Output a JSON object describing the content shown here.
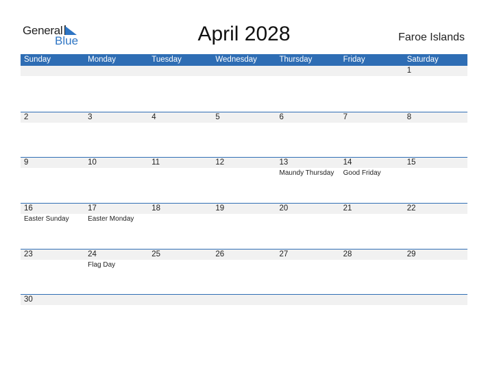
{
  "logo": {
    "word1": "General",
    "word2": "Blue"
  },
  "title": "April 2028",
  "country": "Faroe Islands",
  "weekdays": [
    "Sunday",
    "Monday",
    "Tuesday",
    "Wednesday",
    "Thursday",
    "Friday",
    "Saturday"
  ],
  "weeks": [
    [
      {
        "day": ""
      },
      {
        "day": ""
      },
      {
        "day": ""
      },
      {
        "day": ""
      },
      {
        "day": ""
      },
      {
        "day": ""
      },
      {
        "day": "1"
      }
    ],
    [
      {
        "day": "2"
      },
      {
        "day": "3"
      },
      {
        "day": "4"
      },
      {
        "day": "5"
      },
      {
        "day": "6"
      },
      {
        "day": "7"
      },
      {
        "day": "8"
      }
    ],
    [
      {
        "day": "9"
      },
      {
        "day": "10"
      },
      {
        "day": "11"
      },
      {
        "day": "12"
      },
      {
        "day": "13",
        "holiday": "Maundy Thursday"
      },
      {
        "day": "14",
        "holiday": "Good Friday"
      },
      {
        "day": "15"
      }
    ],
    [
      {
        "day": "16",
        "holiday": "Easter Sunday"
      },
      {
        "day": "17",
        "holiday": "Easter Monday"
      },
      {
        "day": "18"
      },
      {
        "day": "19"
      },
      {
        "day": "20"
      },
      {
        "day": "21"
      },
      {
        "day": "22"
      }
    ],
    [
      {
        "day": "23"
      },
      {
        "day": "24",
        "holiday": "Flag Day"
      },
      {
        "day": "25"
      },
      {
        "day": "26"
      },
      {
        "day": "27"
      },
      {
        "day": "28"
      },
      {
        "day": "29"
      }
    ],
    [
      {
        "day": "30"
      },
      {
        "day": ""
      },
      {
        "day": ""
      },
      {
        "day": ""
      },
      {
        "day": ""
      },
      {
        "day": ""
      },
      {
        "day": ""
      }
    ]
  ],
  "colors": {
    "header": "#2E6DB4",
    "band": "#F1F1F1",
    "logo_blue": "#2E75C4"
  }
}
